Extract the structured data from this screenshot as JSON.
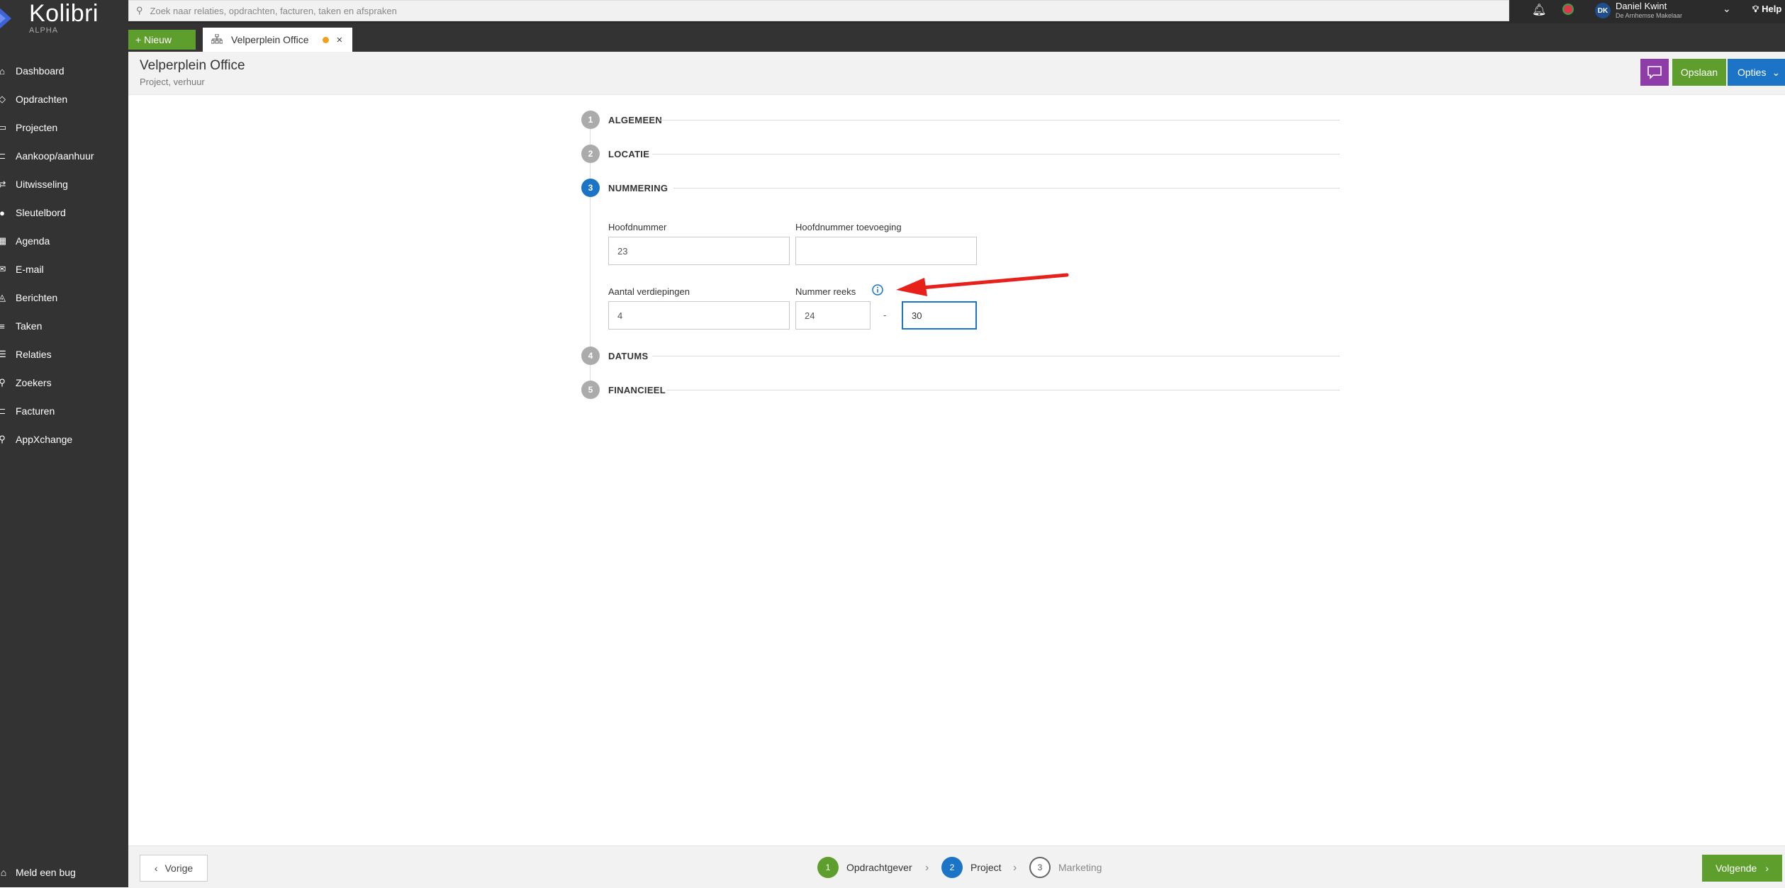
{
  "app": {
    "name": "Kolibri",
    "badge": "ALPHA"
  },
  "nav": {
    "items": [
      {
        "label": "Dashboard",
        "icon": "home-icon",
        "glyph": "⌂"
      },
      {
        "label": "Opdrachten",
        "icon": "assignments-icon",
        "glyph": "◇"
      },
      {
        "label": "Projecten",
        "icon": "projects-icon",
        "glyph": "▭"
      },
      {
        "label": "Aankoop/aanhuur",
        "icon": "purchase-icon",
        "glyph": "⊏"
      },
      {
        "label": "Uitwisseling",
        "icon": "exchange-icon",
        "glyph": "⇄"
      },
      {
        "label": "Sleutelbord",
        "icon": "key-icon",
        "glyph": "●"
      },
      {
        "label": "Agenda",
        "icon": "calendar-icon",
        "glyph": "▦"
      },
      {
        "label": "E-mail",
        "icon": "mail-icon",
        "glyph": "✉"
      },
      {
        "label": "Berichten",
        "icon": "messages-icon",
        "glyph": "◬"
      },
      {
        "label": "Taken",
        "icon": "tasks-icon",
        "glyph": "≡"
      },
      {
        "label": "Relaties",
        "icon": "relations-icon",
        "glyph": "☰"
      },
      {
        "label": "Zoekers",
        "icon": "search-people-icon",
        "glyph": "⚲"
      },
      {
        "label": "Facturen",
        "icon": "invoice-icon",
        "glyph": "⊏"
      },
      {
        "label": "AppXchange",
        "icon": "app-icon",
        "glyph": "⚲"
      }
    ],
    "bug_label": "Meld een bug"
  },
  "search": {
    "placeholder": "Zoek naar relaties, opdrachten, facturen, taken en afspraken"
  },
  "user": {
    "initials": "DK",
    "name": "Daniel Kwint",
    "org": "De Arnhemse Makelaar"
  },
  "help_label": "Help",
  "toolbar": {
    "new_label": "+ Nieuw"
  },
  "tab": {
    "label": "Velperplein Office",
    "close": "×"
  },
  "header": {
    "title": "Velperplein Office",
    "subtitle": "Project, verhuur",
    "save_label": "Opslaan",
    "options_label": "Opties"
  },
  "steps": [
    {
      "num": "1",
      "title": "ALGEMEEN"
    },
    {
      "num": "2",
      "title": "LOCATIE"
    },
    {
      "num": "3",
      "title": "NUMMERING"
    },
    {
      "num": "4",
      "title": "DATUMS"
    },
    {
      "num": "5",
      "title": "FINANCIEEL"
    }
  ],
  "form": {
    "hoofdnummer_label": "Hoofdnummer",
    "hoofdnummer_value": "23",
    "toevoeging_label": "Hoofdnummer toevoeging",
    "toevoeging_value": "",
    "verdiepingen_label": "Aantal verdiepingen",
    "verdiepingen_value": "4",
    "reeks_label": "Nummer reeks",
    "reeks_from": "24",
    "reeks_sep": "-",
    "reeks_to": "30"
  },
  "footer": {
    "prev_label": "Vorige",
    "next_label": "Volgende",
    "wizard": [
      {
        "num": "1",
        "label": "Opdrachtgever",
        "state": "done"
      },
      {
        "num": "2",
        "label": "Project",
        "state": "active"
      },
      {
        "num": "3",
        "label": "Marketing",
        "state": "todo"
      }
    ]
  },
  "colors": {
    "accent_blue": "#1b74c6",
    "green": "#5e9e2c",
    "purple": "#8e3ca8",
    "annotation_red": "#e8201a",
    "sidebar": "#333333"
  }
}
